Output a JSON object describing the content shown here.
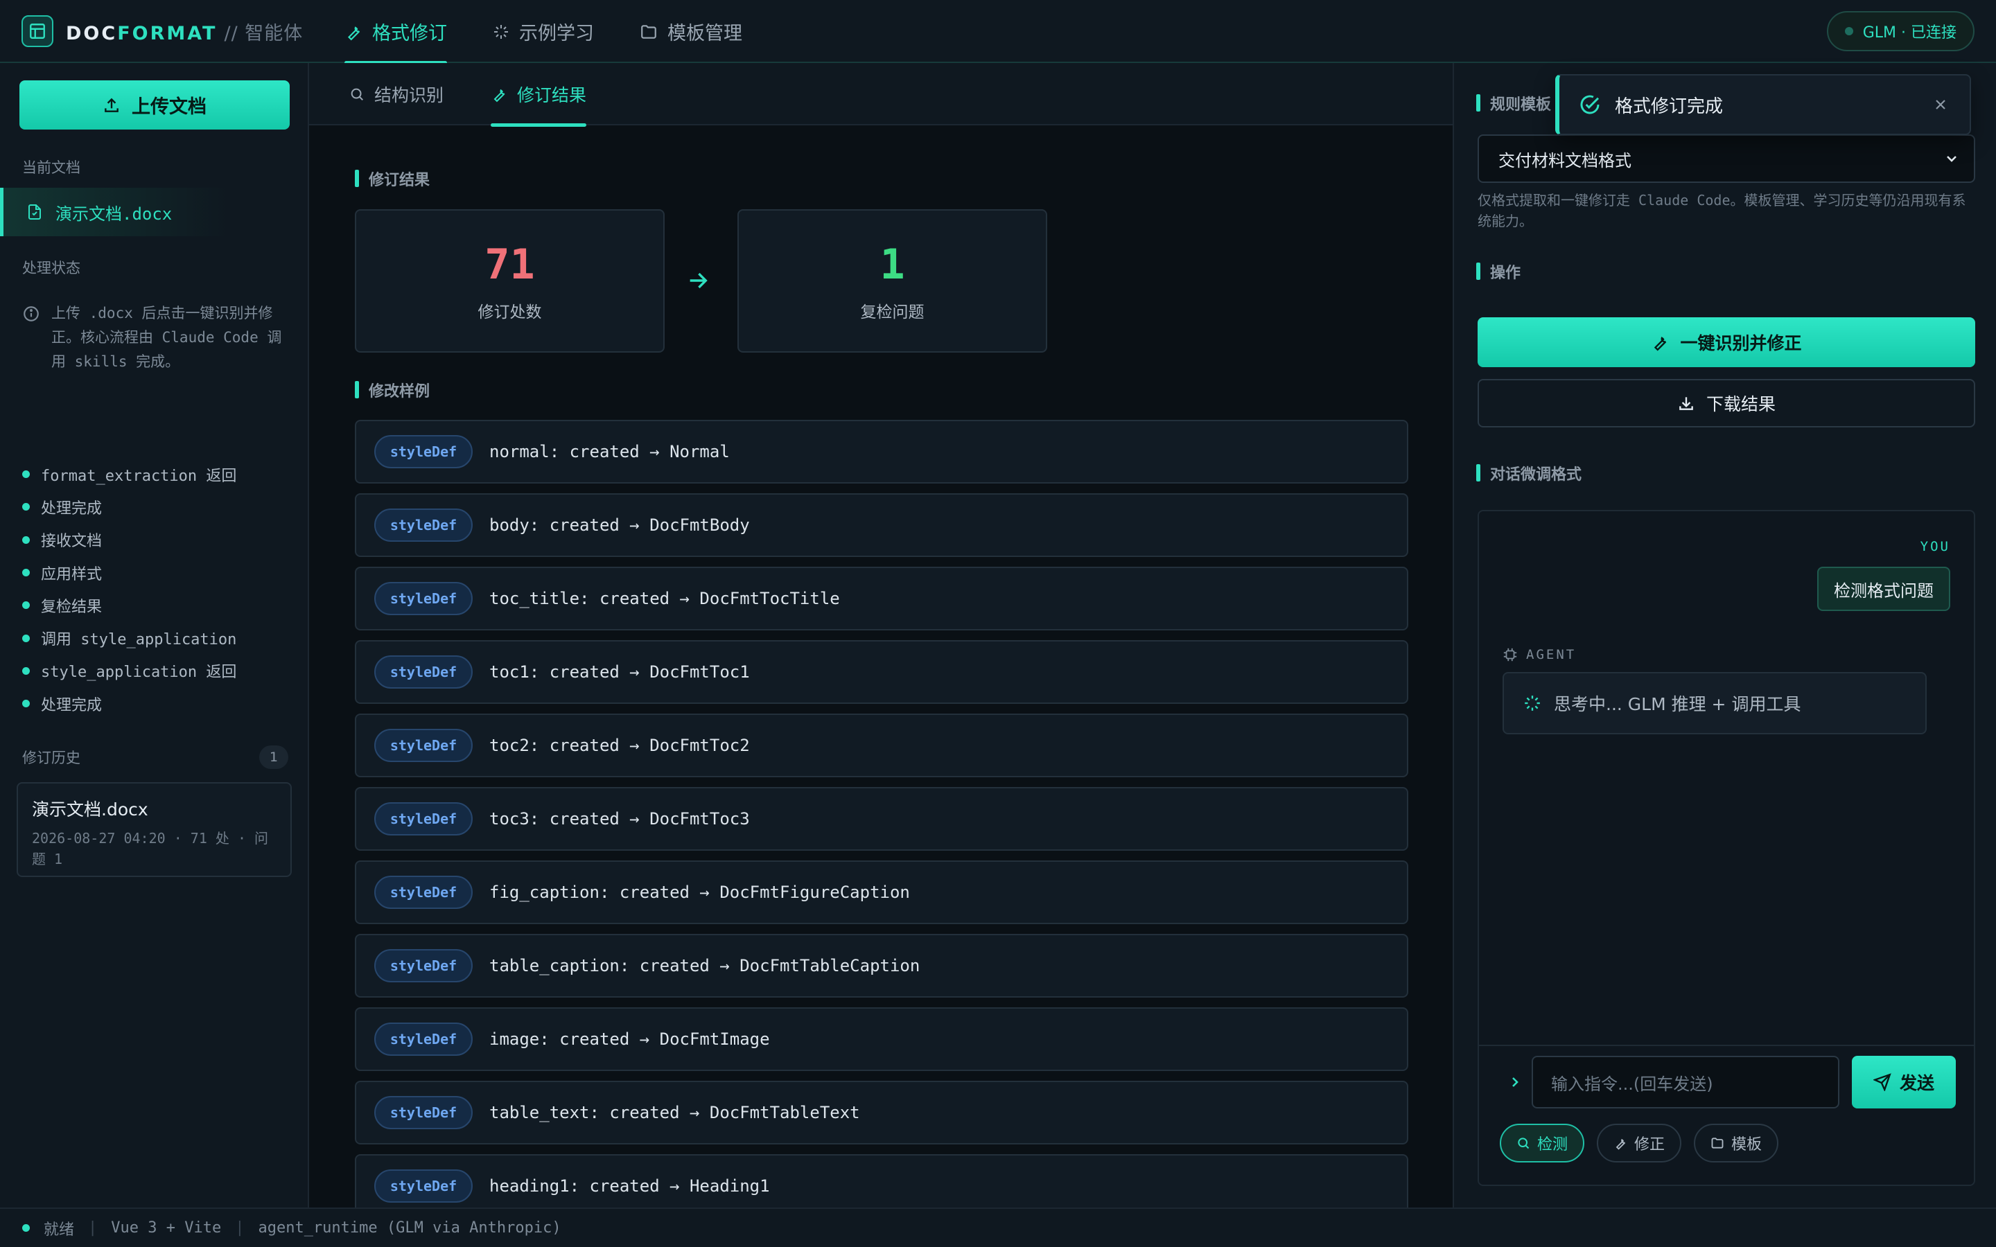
{
  "app": {
    "brand_part1": "DOC",
    "brand_part2": "FORMAT",
    "brand_suffix": "// 智能体",
    "nav_tabs": [
      {
        "label": "格式修订",
        "icon": "wrench-icon",
        "active": true
      },
      {
        "label": "示例学习",
        "icon": "sparkle-icon",
        "active": false
      },
      {
        "label": "模板管理",
        "icon": "folder-icon",
        "active": false
      }
    ],
    "connection_status": "GLM · 已连接"
  },
  "sidebar": {
    "upload_label": "上传文档",
    "current_doc_heading": "当前文档",
    "current_doc_name": "演示文档.docx",
    "process_heading": "处理状态",
    "info_text": "上传 .docx 后点击一键识别并修正。核心流程由 Claude Code 调用 skills 完成。",
    "log_items": [
      "format_extraction 返回",
      "处理完成",
      "接收文档",
      "应用样式",
      "复检结果",
      "调用 style_application",
      "style_application 返回",
      "处理完成"
    ],
    "history_heading": "修订历史",
    "history_count": "1",
    "history": [
      {
        "title": "演示文档.docx",
        "meta": "2026-08-27 04:20 · 71 处 · 问题 1"
      }
    ]
  },
  "main": {
    "subtabs": [
      {
        "label": "结构识别",
        "icon": "search-icon",
        "active": false
      },
      {
        "label": "修订结果",
        "icon": "wrench-icon",
        "active": true
      }
    ],
    "result_heading": "修订结果",
    "stats": [
      {
        "value": "71",
        "label": "修订处数",
        "color": "#f07178"
      },
      {
        "value": "1",
        "label": "复检问题",
        "color": "#3ddc84"
      }
    ],
    "samples_heading": "修改样例",
    "samples": [
      {
        "tag": "styleDef",
        "text": "normal: created → Normal"
      },
      {
        "tag": "styleDef",
        "text": "body: created → DocFmtBody"
      },
      {
        "tag": "styleDef",
        "text": "toc_title: created → DocFmtTocTitle"
      },
      {
        "tag": "styleDef",
        "text": "toc1: created → DocFmtToc1"
      },
      {
        "tag": "styleDef",
        "text": "toc2: created → DocFmtToc2"
      },
      {
        "tag": "styleDef",
        "text": "toc3: created → DocFmtToc3"
      },
      {
        "tag": "styleDef",
        "text": "fig_caption: created → DocFmtFigureCaption"
      },
      {
        "tag": "styleDef",
        "text": "table_caption: created → DocFmtTableCaption"
      },
      {
        "tag": "styleDef",
        "text": "image: created → DocFmtImage"
      },
      {
        "tag": "styleDef",
        "text": "table_text: created → DocFmtTableText"
      },
      {
        "tag": "styleDef",
        "text": "heading1: created → Heading1"
      }
    ]
  },
  "right": {
    "template_heading": "规则模板",
    "template_selected": "交付材料文档格式",
    "template_note": "仅格式提取和一键修订走 Claude Code。模板管理、学习历史等仍沿用现有系统能力。",
    "ops_heading": "操作",
    "primary_action": "一键识别并修正",
    "download_action": "下载结果",
    "chat_heading": "对话微调格式",
    "chat": {
      "you_label": "YOU",
      "you_message": "检测格式问题",
      "agent_label": "AGENT",
      "agent_message": "思考中... GLM 推理 + 调用工具",
      "input_placeholder": "输入指令...(回车发送)",
      "send_label": "发送",
      "quick_actions": [
        {
          "label": "检测",
          "icon": "search-icon",
          "active": true
        },
        {
          "label": "修正",
          "icon": "wrench-icon",
          "active": false
        },
        {
          "label": "模板",
          "icon": "folder-icon",
          "active": false
        }
      ]
    }
  },
  "toast": {
    "message": "格式修订完成"
  },
  "statusbar": {
    "state": "就绪",
    "stack": "Vue 3 + Vite",
    "runtime": "agent_runtime (GLM via Anthropic)"
  },
  "colors": {
    "accent": "#2ee0c0",
    "bg": "#0d141b",
    "panel": "#0f1820",
    "danger_num": "#f07178",
    "success_num": "#3ddc84"
  }
}
